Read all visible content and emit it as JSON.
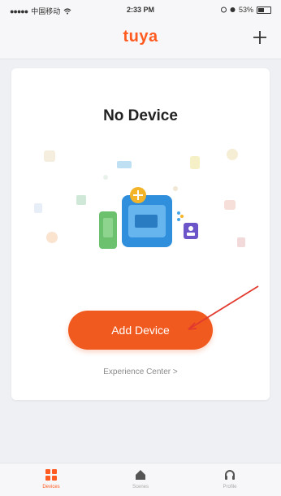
{
  "status_bar": {
    "carrier": "中国移动",
    "time": "2:33 PM",
    "battery_text": "53%",
    "battery_level": 0.53
  },
  "navbar": {
    "logo_text": "tuya",
    "add_icon": "plus-icon",
    "accent_color": "#ff5a1f"
  },
  "main": {
    "empty_title": "No Device",
    "add_button_label": "Add Device",
    "experience_link": "Experience Center >"
  },
  "tabbar": {
    "tabs": [
      {
        "label": "Devices",
        "icon": "grid-icon",
        "active": true
      },
      {
        "label": "Scenes",
        "icon": "home-icon",
        "active": false
      },
      {
        "label": "Profile",
        "icon": "headset-icon",
        "active": false
      }
    ]
  }
}
